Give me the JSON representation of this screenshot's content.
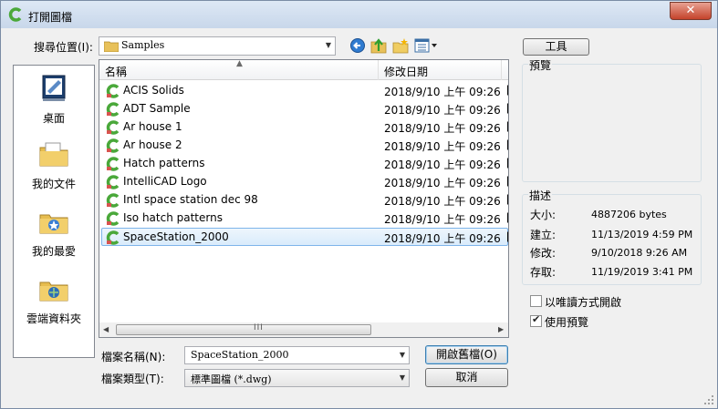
{
  "window": {
    "title": "打開圖檔",
    "close_label": "✕"
  },
  "location": {
    "label": "搜尋位置(I):",
    "value": "Samples"
  },
  "toolbar": {
    "tools_label": "工具"
  },
  "places": [
    {
      "label": "桌面",
      "icon": "desktop-icon"
    },
    {
      "label": "我的文件",
      "icon": "my-documents-icon"
    },
    {
      "label": "我的最愛",
      "icon": "favorites-icon"
    },
    {
      "label": "雲端資料夾",
      "icon": "cloud-folder-icon"
    }
  ],
  "filelist": {
    "columns": [
      "名稱",
      "修改日期"
    ],
    "files": [
      {
        "name": "ACIS Solids",
        "date": "2018/9/10 上午 09:26",
        "extra": "["
      },
      {
        "name": "ADT Sample",
        "date": "2018/9/10 上午 09:26",
        "extra": "["
      },
      {
        "name": "Ar house 1",
        "date": "2018/9/10 上午 09:26",
        "extra": "["
      },
      {
        "name": "Ar house 2",
        "date": "2018/9/10 上午 09:26",
        "extra": "["
      },
      {
        "name": "Hatch patterns",
        "date": "2018/9/10 上午 09:26",
        "extra": "["
      },
      {
        "name": "IntelliCAD Logo",
        "date": "2018/9/10 上午 09:26",
        "extra": "["
      },
      {
        "name": "Intl space station dec 98",
        "date": "2018/9/10 上午 09:26",
        "extra": "["
      },
      {
        "name": "Iso hatch patterns",
        "date": "2018/9/10 上午 09:26",
        "extra": "["
      },
      {
        "name": "SpaceStation_2000",
        "date": "2018/9/10 上午 09:26",
        "extra": "["
      }
    ],
    "scroll_grip": "III"
  },
  "preview": {
    "title": "預覽"
  },
  "description": {
    "title": "描述",
    "size_label": "大小:",
    "size_value": "4887206 bytes",
    "created_label": "建立:",
    "created_value": "11/13/2019 4:59 PM",
    "modified_label": "修改:",
    "modified_value": "9/10/2018 9:26 AM",
    "accessed_label": "存取:",
    "accessed_value": "11/19/2019 3:41 PM"
  },
  "options": {
    "readonly_label": "以唯讀方式開啟",
    "readonly_checked": false,
    "usepreview_label": "使用預覽",
    "usepreview_checked": true
  },
  "filename": {
    "label": "檔案名稱(N):",
    "value": "SpaceStation_2000"
  },
  "filetype": {
    "label": "檔案類型(T):",
    "value": "標準圖檔 (*.dwg)"
  },
  "buttons": {
    "open_label": "開啟舊檔(O)",
    "cancel_label": "取消"
  }
}
